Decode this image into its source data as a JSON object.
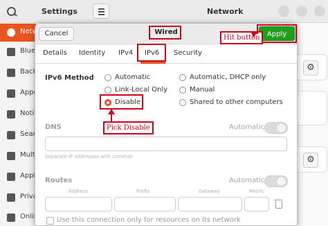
{
  "background_window": {
    "settings_title": "Settings",
    "network_title": "Network",
    "sidebar_items": [
      {
        "label": "Netw",
        "icon": "network-icon",
        "active": true
      },
      {
        "label": "Blue",
        "icon": "bluetooth-icon",
        "active": false
      },
      {
        "label": "Back",
        "icon": "background-icon",
        "active": false
      },
      {
        "label": "Appe",
        "icon": "appearance-icon",
        "active": false
      },
      {
        "label": "Noti",
        "icon": "notifications-icon",
        "active": false
      },
      {
        "label": "Sear",
        "icon": "search-icon",
        "active": false
      },
      {
        "label": "Mult",
        "icon": "multitasking-icon",
        "active": false
      },
      {
        "label": "Appl",
        "icon": "applications-icon",
        "active": false
      },
      {
        "label": "Priva",
        "icon": "privacy-icon",
        "active": false
      },
      {
        "label": "Onlin",
        "icon": "online-accounts-icon",
        "active": false
      }
    ]
  },
  "dialog": {
    "cancel_label": "Cancel",
    "title": "Wired",
    "apply_label": "Apply",
    "tabs": [
      {
        "label": "Details",
        "active": false
      },
      {
        "label": "Identity",
        "active": false
      },
      {
        "label": "IPv4",
        "active": false
      },
      {
        "label": "IPv6",
        "active": true
      },
      {
        "label": "Security",
        "active": false
      }
    ],
    "ipv6_method_label": "IPv6 Method",
    "methods": [
      {
        "label": "Automatic",
        "checked": false
      },
      {
        "label": "Automatic, DHCP only",
        "checked": false
      },
      {
        "label": "Link-Local Only",
        "checked": false
      },
      {
        "label": "Manual",
        "checked": false
      },
      {
        "label": "Disable",
        "checked": true
      },
      {
        "label": "Shared to other computers",
        "checked": false
      }
    ],
    "dns_label": "DNS",
    "dns_automatic_label": "Automatic",
    "dns_hint": "Separate IP addresses with commas",
    "routes_label": "Routes",
    "routes_automatic_label": "Automatic",
    "routes_columns": [
      "Address",
      "Prefix",
      "Gateway",
      "Metric"
    ],
    "only_resources_label": "Use this connection only for resources on its network"
  },
  "annotations": {
    "hit_button": "Hit button",
    "pick_disable": "Pick Disable",
    "color": "#d0021b"
  },
  "colors": {
    "accent": "#e95420",
    "apply_green": "#1fa01b"
  }
}
